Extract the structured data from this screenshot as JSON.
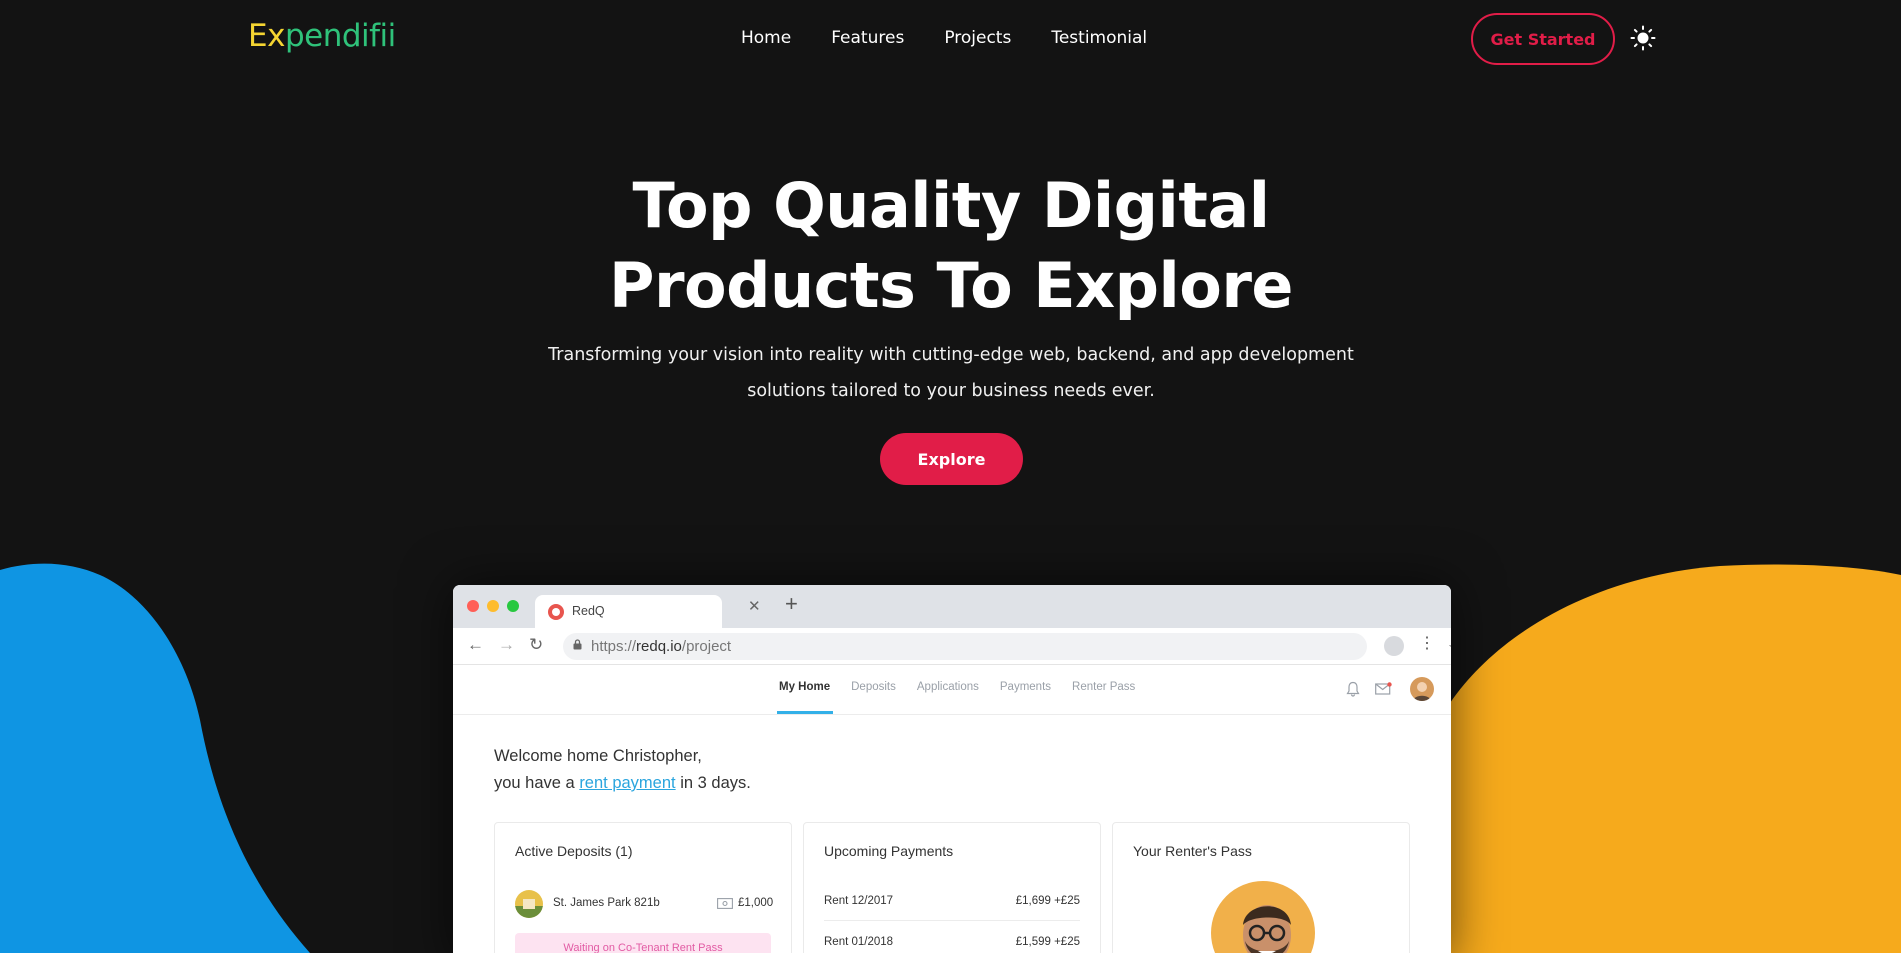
{
  "brand": {
    "logo_part1": "Ex",
    "logo_part2": "pendifii",
    "color_part1": "#f5d532",
    "color_part2": "#2fc27a"
  },
  "nav": {
    "items": [
      "Home",
      "Features",
      "Projects",
      "Testimonial"
    ],
    "cta_label": "Get Started",
    "theme_icon": "sun-icon"
  },
  "hero": {
    "title_line1": "Top Quality Digital",
    "title_line2": "Products To Explore",
    "subtitle_line1": "Transforming your vision into reality with cutting-edge web, backend, and app development",
    "subtitle_line2": "solutions tailored to your business needs ever.",
    "button_label": "Explore"
  },
  "colors": {
    "accent": "#e11d48",
    "blob_left": "#0f95e3",
    "blob_right": "#f6aa1c",
    "background": "#131313"
  },
  "mockup": {
    "tab_title": "RedQ",
    "url_prefix": "https://",
    "url_host": "redq.io",
    "url_path": "/project",
    "app_nav": [
      "My Home",
      "Deposits",
      "Applications",
      "Payments",
      "Renter Pass"
    ],
    "welcome_line1": "Welcome home Christopher,",
    "welcome_pre": "you have a ",
    "welcome_link": "rent payment",
    "welcome_post": " in 3 days.",
    "cards": {
      "deposits": {
        "title": "Active Deposits (1)",
        "item_name": "St. James Park 821b",
        "item_amount": "£1,000",
        "status": "Waiting on Co-Tenant Rent Pass"
      },
      "payments": {
        "title": "Upcoming Payments",
        "rows": [
          {
            "label": "Rent 12/2017",
            "amount": "£1,699  +£25"
          },
          {
            "label": "Rent 01/2018",
            "amount": "£1,599  +£25"
          }
        ]
      },
      "pass": {
        "title": "Your Renter's Pass"
      }
    }
  }
}
